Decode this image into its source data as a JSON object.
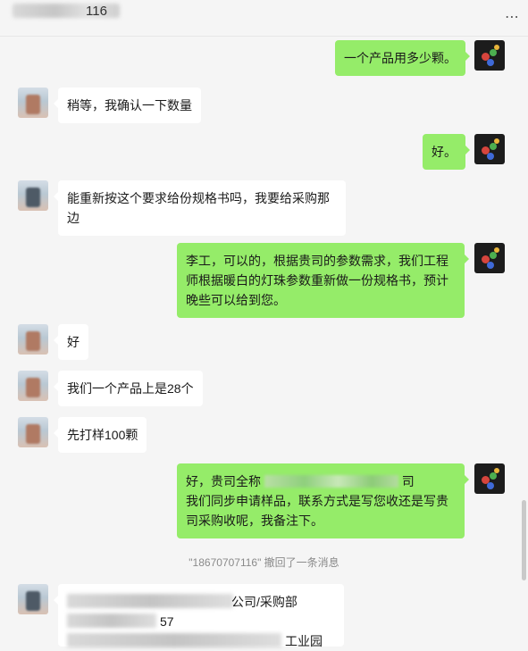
{
  "header": {
    "title_fragment": "116"
  },
  "messages": [
    {
      "side": "me",
      "text": "一个产品用多少颗。"
    },
    {
      "side": "them",
      "text": "稍等，我确认一下数量"
    },
    {
      "side": "me",
      "text": "好。"
    },
    {
      "side": "them",
      "lines": [
        "能重新按这个要求给份规格书吗，我要给采购那",
        "边"
      ]
    },
    {
      "side": "me",
      "lines": [
        "李工，可以的，根据贵司的参数需求，我们工程",
        "师根据暖白的灯珠参数重新做一份规格书，预计",
        "晚些可以给到您。"
      ]
    },
    {
      "side": "them",
      "text": "好"
    },
    {
      "side": "them",
      "text": "我们一个产品上是28个"
    },
    {
      "side": "them",
      "text": "先打样100颗"
    },
    {
      "side": "me",
      "line1_start": "好，贵司全称",
      "line1_end": "司",
      "lines": [
        "我们同步申请样品，联系方式是写您收还是写贵",
        "司采购收呢，我备注下。"
      ]
    },
    {
      "side": "them",
      "line1_end": "公司/采购部",
      "line2_end": "57",
      "line3_end": "工业园"
    }
  ],
  "system_notice": "\"18670707116\" 撤回了一条消息",
  "colors": {
    "me_bubble": "#95ec69",
    "them_bubble": "#ffffff",
    "background": "#f5f5f5"
  }
}
